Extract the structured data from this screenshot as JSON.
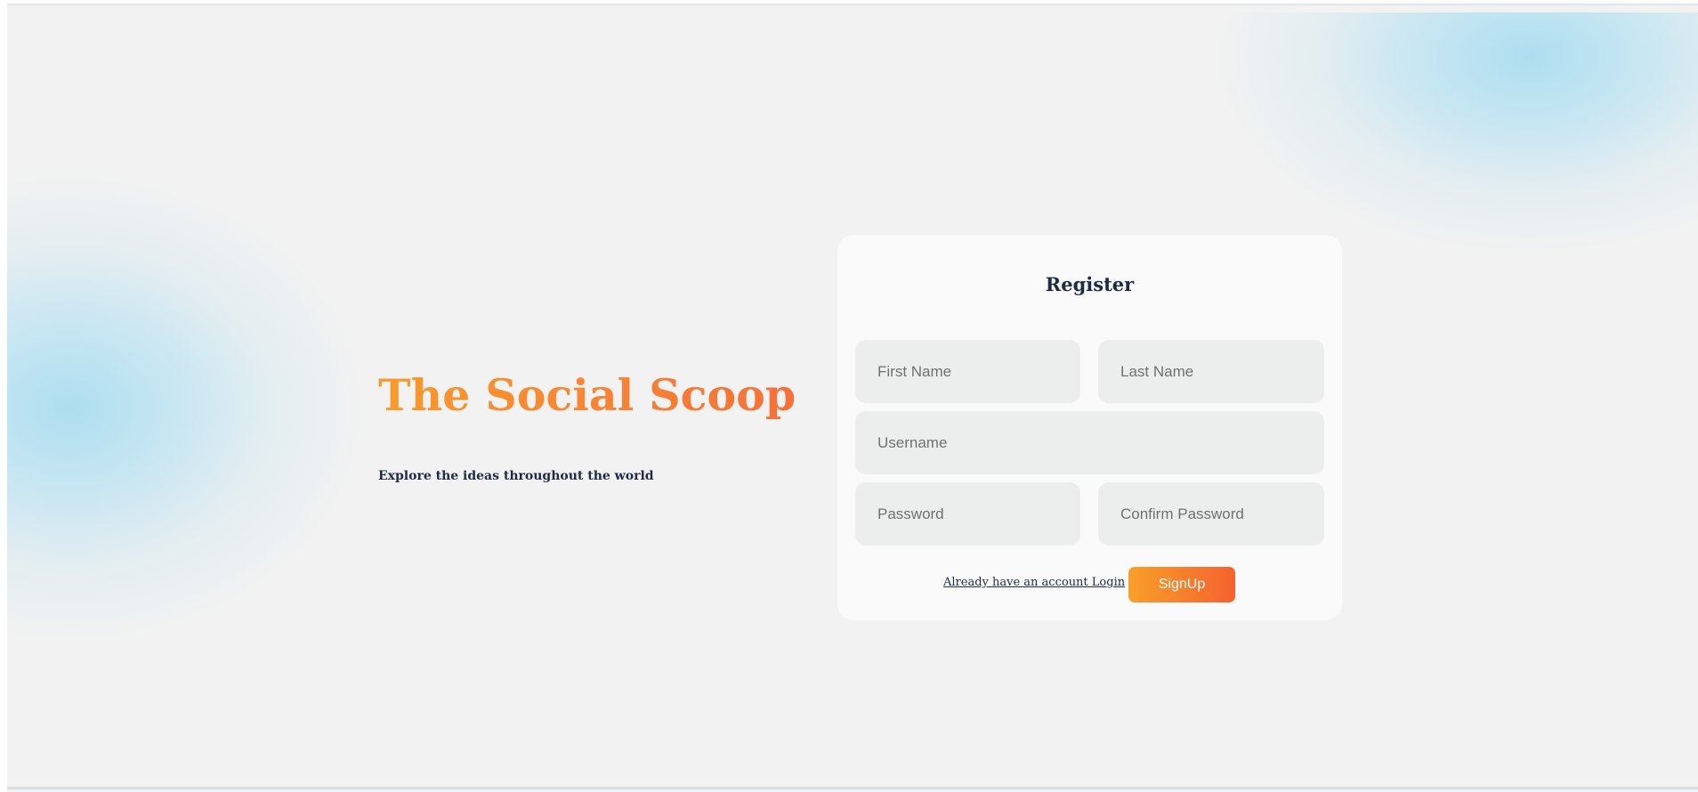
{
  "brand": {
    "title": "The Social Scoop",
    "tagline": "Explore the ideas throughout the world"
  },
  "register": {
    "title": "Register",
    "fields": {
      "first_name": {
        "placeholder": "First Name",
        "value": ""
      },
      "last_name": {
        "placeholder": "Last Name",
        "value": ""
      },
      "username": {
        "placeholder": "Username",
        "value": ""
      },
      "password": {
        "placeholder": "Password",
        "value": ""
      },
      "confirm_password": {
        "placeholder": "Confirm Password",
        "value": ""
      }
    },
    "login_link": "Already have an account Login",
    "signup_label": "SignUp"
  },
  "colors": {
    "background": "#f2f2f2",
    "card": "#fafafa",
    "input": "#eceeed",
    "accent_start": "#f99a2c",
    "accent_end": "#f5622f",
    "text_dark": "#1d2b45",
    "blob_blue": "#aaddf0"
  }
}
